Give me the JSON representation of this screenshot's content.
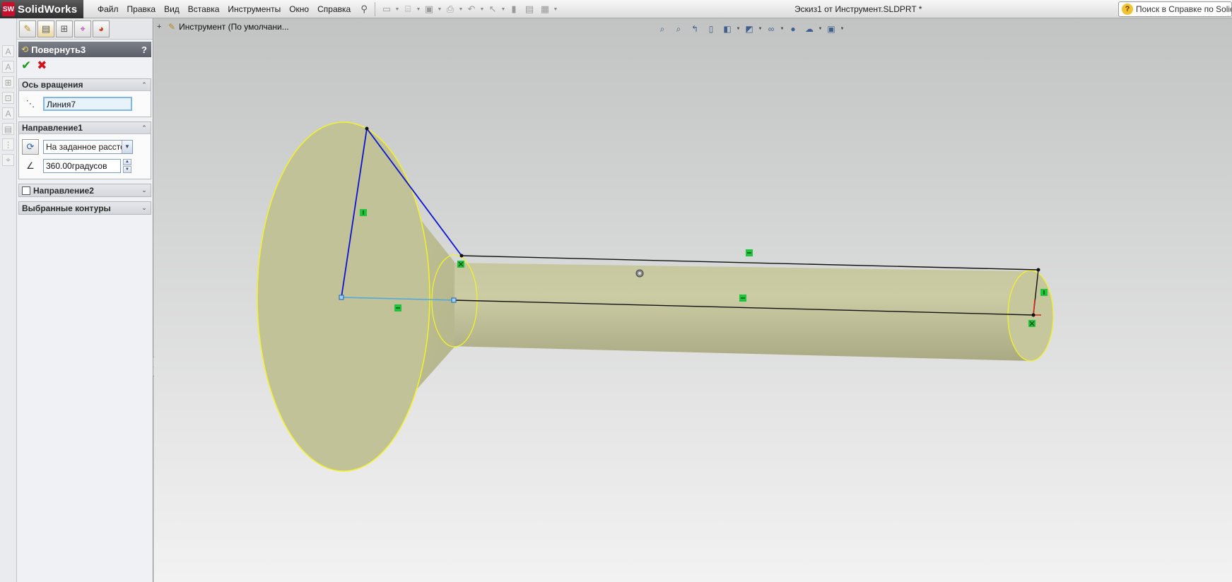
{
  "app": {
    "name": "SolidWorks",
    "logo_mark": "SW",
    "document_title": "Эскиз1 от Инструмент.SLDPRT *"
  },
  "menu": [
    "Файл",
    "Правка",
    "Вид",
    "Вставка",
    "Инструменты",
    "Окно",
    "Справка"
  ],
  "help_search": {
    "placeholder": "Поиск в Справке по SolidWorks"
  },
  "toolbar_icons": [
    "new-icon",
    "open-icon",
    "save-icon",
    "print-icon",
    "undo-icon",
    "select-icon",
    "rebuild-icon",
    "file-properties-icon",
    "options-icon"
  ],
  "property_manager": {
    "tabs": [
      "feature-manager-icon",
      "property-manager-icon",
      "configuration-manager-icon",
      "dimxpert-icon",
      "display-manager-icon"
    ],
    "feature_name": "Повернуть3",
    "help_label": "?",
    "groups": {
      "axis": {
        "title": "Ось вращения",
        "value": "Линия7"
      },
      "direction1": {
        "title": "Направление1",
        "end_condition": "На заданное расстояние",
        "angle": "360.00градусов"
      },
      "direction2": {
        "title": "Направление2",
        "checked": false
      },
      "contours": {
        "title": "Выбранные контуры"
      }
    }
  },
  "graphics": {
    "tree_flyout": "Инструмент  (По умолчани..."
  },
  "colors": {
    "model_fill": "#c2c298",
    "edge_highlight": "#ffff22",
    "sketch_line": "#0a14d0",
    "relation_badge": "#1ec43c",
    "panel_header": "#6a6e77"
  }
}
